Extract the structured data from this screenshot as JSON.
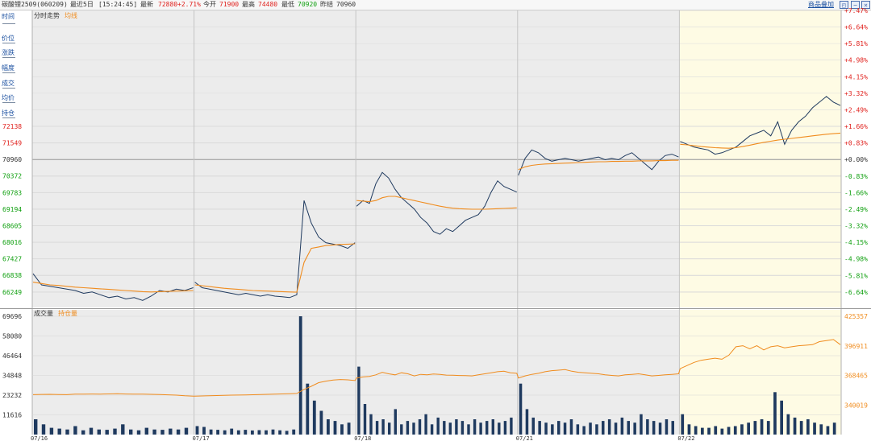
{
  "header": {
    "instrument": "碳酸锂2509(060209)",
    "period": "最近5日",
    "time": "[15:24:45]",
    "latest_label": "最新",
    "latest_value": "72880",
    "change_pct": "+2.71%",
    "open_label": "今开",
    "open_value": "71900",
    "high_label": "最高",
    "high_value": "74480",
    "low_label": "最低",
    "low_value": "70920",
    "prev_close_label": "昨结",
    "prev_close_value": "70960",
    "superpose_label": "商品叠加"
  },
  "sidebar": {
    "items": [
      "时间",
      "价位",
      "涨跌",
      "幅度",
      "成交",
      "均价",
      "持仓"
    ]
  },
  "colors": {
    "price_line": "#1f3a5f",
    "avg_line": "#f08c1e",
    "up_text": "#e0201c",
    "down_text": "#10a010",
    "hist_bg": "#ececec",
    "today_bg": "#fefbe4",
    "volume_bar": "#1f3a5f",
    "open_interest_line": "#f08c1e"
  },
  "chart_data": [
    {
      "type": "line",
      "panel_label": "分时走势",
      "avg_label": "均线",
      "days": [
        "07/16",
        "07/17",
        "07/18",
        "07/21",
        "07/22"
      ],
      "prev_close": 70960,
      "y_ticks_left": [
        72138,
        71549,
        70960,
        70372,
        69783,
        69194,
        68605,
        68016,
        67427,
        66838,
        66249
      ],
      "y_ticks_right": [
        "+7.47%",
        "+6.64%",
        "+5.81%",
        "+4.98%",
        "+4.15%",
        "+3.32%",
        "+2.49%",
        "+1.66%",
        "+0.83%",
        "+0.00%",
        "-0.83%",
        "-1.66%",
        "-2.49%",
        "-3.32%",
        "-4.15%",
        "-4.98%",
        "-5.81%",
        "-6.64%"
      ],
      "ylim": [
        65700,
        76260
      ],
      "series": [
        {
          "values_by_day": [
            [
              66900,
              66500,
              66450,
              66400,
              66350,
              66300,
              66200,
              66250,
              66150,
              66050,
              66100,
              66000,
              66050,
              65950,
              66100,
              66300,
              66250,
              66350,
              66300,
              66400
            ],
            [
              66600,
              66400,
              66350,
              66300,
              66250,
              66200,
              66150,
              66200,
              66150,
              66100,
              66150,
              66100,
              66080,
              66050,
              66150,
              69500,
              68700,
              68200,
              68000,
              67950,
              67900,
              67800,
              68000
            ],
            [
              69300,
              69500,
              69400,
              70100,
              70500,
              70300,
              69900,
              69600,
              69400,
              69200,
              68900,
              68700,
              68400,
              68300,
              68500,
              68400,
              68600,
              68800,
              68900,
              69000,
              69300,
              69800,
              70200,
              70000,
              69900,
              69800
            ],
            [
              70400,
              71000,
              71300,
              71200,
              71000,
              70900,
              70950,
              71000,
              70950,
              70900,
              70950,
              71000,
              71050,
              70950,
              71000,
              70950,
              71100,
              71200,
              71000,
              70800,
              70600,
              70900,
              71100,
              71150,
              71050
            ],
            [
              71600,
              71500,
              71400,
              71350,
              71300,
              71150,
              71200,
              71300,
              71400,
              71600,
              71800,
              71900,
              72000,
              71800,
              72300,
              71500,
              72000,
              72300,
              72500,
              72800,
              73000,
              73200,
              73000,
              72880
            ]
          ]
        },
        {
          "values_by_day": [
            [
              66600,
              66550,
              66500,
              66480,
              66450,
              66420,
              66400,
              66380,
              66360,
              66340,
              66320,
              66300,
              66280,
              66260,
              66250,
              66260,
              66270,
              66280,
              66290,
              66300
            ],
            [
              66500,
              66470,
              66440,
              66410,
              66380,
              66360,
              66340,
              66320,
              66300,
              66290,
              66280,
              66270,
              66260,
              66250,
              66240,
              67300,
              67800,
              67850,
              67900,
              67920,
              67940,
              67950,
              67960
            ],
            [
              69500,
              69480,
              69460,
              69500,
              69600,
              69650,
              69650,
              69600,
              69550,
              69500,
              69450,
              69400,
              69350,
              69300,
              69260,
              69230,
              69210,
              69200,
              69190,
              69190,
              69190,
              69200,
              69210,
              69220,
              69230,
              69240
            ],
            [
              70600,
              70700,
              70750,
              70780,
              70800,
              70810,
              70820,
              70830,
              70840,
              70850,
              70860,
              70870,
              70880,
              70880,
              70890,
              70890,
              70900,
              70900,
              70910,
              70910,
              70910,
              70920,
              70920,
              70930,
              70930
            ],
            [
              71500,
              71480,
              71450,
              71420,
              71400,
              71380,
              71370,
              71360,
              71380,
              71420,
              71470,
              71520,
              71570,
              71610,
              71650,
              71680,
              71710,
              71740,
              71770,
              71800,
              71830,
              71860,
              71880,
              71900
            ]
          ]
        }
      ]
    },
    {
      "type": "bar",
      "panel_label": "成交量",
      "oi_label": "持仓量",
      "y_ticks_left": [
        69696,
        58080,
        46464,
        34848,
        23232,
        11616
      ],
      "y_ticks_right": [
        425357,
        396911,
        368465,
        340019
      ],
      "ylim": [
        0,
        69696
      ],
      "volume_by_day": [
        [
          9000,
          6000,
          4000,
          3500,
          3000,
          5000,
          2500,
          4000,
          3000,
          2800,
          3500,
          6000,
          3000,
          2500,
          4000,
          3000,
          2800,
          3500,
          3000,
          4000
        ],
        [
          5000,
          4500,
          3000,
          2800,
          2500,
          3500,
          2500,
          2800,
          2400,
          2600,
          2500,
          3000,
          2500,
          2200,
          3000,
          69696,
          30000,
          20000,
          14000,
          9000,
          8000,
          6000,
          7000
        ],
        [
          40000,
          18000,
          12000,
          8000,
          9000,
          7000,
          15000,
          6000,
          8000,
          7000,
          9000,
          12000,
          6000,
          10000,
          8000,
          7000,
          9000,
          8000,
          6000,
          9000,
          7000,
          8000,
          9000,
          7000,
          8000,
          10000
        ],
        [
          30000,
          15000,
          10000,
          8000,
          7000,
          6000,
          8000,
          7000,
          9000,
          6000,
          5000,
          7000,
          6000,
          8000,
          9000,
          7000,
          10000,
          8000,
          7000,
          12000,
          9000,
          8000,
          7000,
          9000,
          8000
        ],
        [
          12000,
          6000,
          5000,
          4000,
          4000,
          5000,
          3500,
          4500,
          5000,
          6000,
          7000,
          8000,
          9000,
          8000,
          25000,
          20000,
          12000,
          10000,
          8000,
          9000,
          7000,
          6000,
          5000,
          7000
        ]
      ],
      "oi_by_day": [
        [
          350000,
          350200,
          350300,
          350100,
          350000,
          350400,
          350500,
          350600,
          350500,
          350700,
          350800,
          350600,
          350500,
          350400,
          350300,
          350100,
          349800,
          349500,
          348900,
          348500
        ],
        [
          348600,
          348700,
          348900,
          349100,
          349300,
          349500,
          349600,
          349700,
          349900,
          350100,
          350300,
          350500,
          350700,
          350900,
          351100,
          355000,
          358000,
          361500,
          363000,
          364000,
          364500,
          364200,
          363500
        ],
        [
          366000,
          367000,
          367500,
          369000,
          371500,
          370000,
          369000,
          371000,
          370000,
          368000,
          369500,
          369000,
          369800,
          369400,
          368800,
          368600,
          368400,
          368200,
          368000,
          369000,
          370000,
          371000,
          372000,
          372500,
          371000,
          370500
        ],
        [
          366000,
          368000,
          369500,
          370500,
          372000,
          373000,
          373500,
          374000,
          372500,
          371500,
          371000,
          370500,
          370000,
          369000,
          368500,
          368000,
          369000,
          369500,
          370000,
          369000,
          368000,
          368500,
          369000,
          369500,
          370000
        ],
        [
          375000,
          378000,
          381000,
          383000,
          384000,
          385000,
          384000,
          388000,
          396000,
          397000,
          394000,
          397000,
          393000,
          396000,
          397000,
          395000,
          396000,
          397000,
          397500,
          398000,
          401000,
          402000,
          403000,
          398000
        ]
      ]
    }
  ]
}
